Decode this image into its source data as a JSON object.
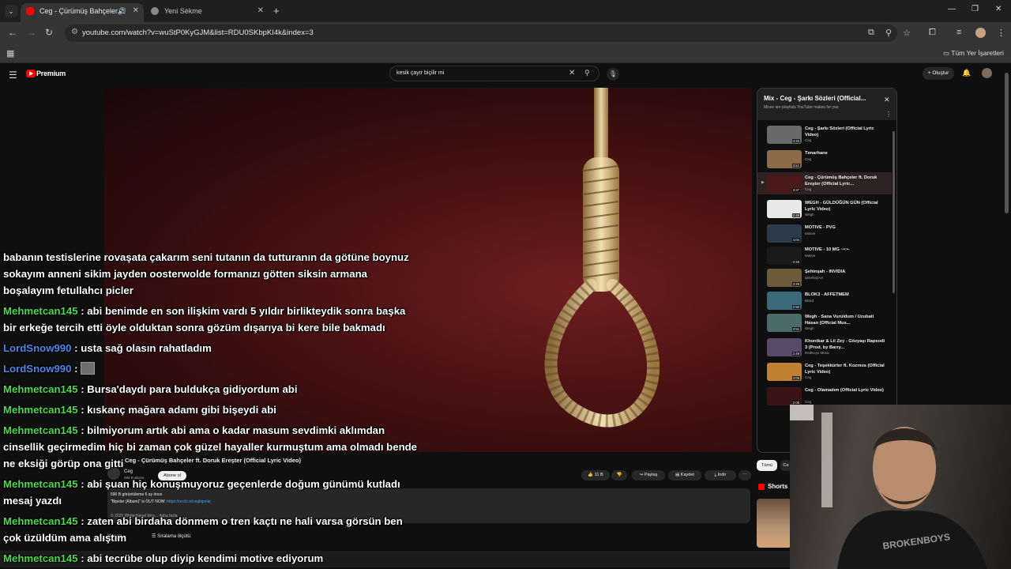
{
  "browser": {
    "tabs": [
      {
        "title": "Ceg - Çürümüş Bahçeler ft.",
        "active": true
      },
      {
        "title": "Yeni Sekme",
        "active": false
      }
    ],
    "url": "youtube.com/watch?v=wuStP0KyGJM&list=RDU0SKbpKI4k&index=3",
    "bookmarks_label": "Tüm Yer İşaretleri"
  },
  "youtube": {
    "brand": "Premium",
    "search_query": "kesik çayır biçilir mi",
    "create_label": "Oluştur",
    "video_title": "Ceg - Çürümüş Bahçeler ft. Doruk Ereşter (Official Lyric Video)",
    "channel": "Ceg",
    "channel_subs": "294 B abone",
    "subscribe_label": "Abone ol",
    "likes": "11 B",
    "share_label": "Paylaş",
    "save_label": "Kaydet",
    "download_label": "İndir",
    "desc_views": "590 B görüntüleme  6 ay önce",
    "desc_line2": "\"Bipolar (Album)\" is OUT NOW: ",
    "desc_link": "https://orcd.co/cegbipolar",
    "desc_line3": "© 2025 Whitechapel Mus...  daha fazla",
    "comments_label": "Yorum",
    "sort_label": "Sıralama ölçütü:",
    "chips": [
      "Tümü",
      "Ce"
    ],
    "shorts_label": "Shorts"
  },
  "playlist": {
    "title": "Mix - Ceg - Şarkı Sözleri (Official...",
    "subtitle": "Mixes are playlists YouTube makes for you",
    "items": [
      {
        "title": "Ceg - Şarkı Sözleri (Official Lyric Video)",
        "artist": "Ceg",
        "duration": "4:33"
      },
      {
        "title": "Tımarhane",
        "artist": "Ceg",
        "duration": "3:51"
      },
      {
        "title": "Ceg - Çürümüş Bahçeler ft. Doruk Ereşter (Official Lyric...",
        "artist": "Ceg",
        "duration": "3:37"
      },
      {
        "title": "WEGH - GÜLDÜĞÜN GÜN (Official Lyric Video)",
        "artist": "Wegh",
        "duration": "2:49"
      },
      {
        "title": "MOTIVE - PVG",
        "artist": "Motive",
        "duration": "4:04"
      },
      {
        "title": "MOTIVE - 10 MG ~•:•-",
        "artist": "Motive",
        "duration": "2:28"
      },
      {
        "title": "Şehinşah - INVIDIA",
        "artist": "ŞEHİNŞAH",
        "duration": "3:29"
      },
      {
        "title": "BLOK3 - AFFETMEM",
        "artist": "Blok3",
        "duration": "2:50"
      },
      {
        "title": "Wegh - Sana Vuruldum / Uzubati Hasan (Official Mus...",
        "artist": "Wegh",
        "duration": "3:51"
      },
      {
        "title": "Khontkar & Lil Zey - Gözyaşı Rapsodi 3 (Prod. by Barry...",
        "artist": "RedKeys Music",
        "duration": "2:49"
      },
      {
        "title": "Ceg - Teşekkürler ft. Kozmos (Official Lyric Video)",
        "artist": "Ceg",
        "duration": "4:05"
      },
      {
        "title": "Ceg - Olamadım (Official Lyric Video)",
        "artist": "Ceg",
        "duration": "2:06"
      }
    ]
  },
  "chat": {
    "messages": [
      {
        "user": "",
        "text": "babanın testislerine rovaşata çakarım seni tutanın da tutturanın da götüne boynuz"
      },
      {
        "user": "",
        "text": "sokayım anneni sikim jayden oosterwolde formanızı götten siksin armana"
      },
      {
        "user": "",
        "text": "boşalayım fetullahcı picler"
      },
      {
        "user": "Mehmetcan145",
        "text": " : abi benimde en son ilişkim vardı 5 yıldır birlikteydik sonra başka"
      },
      {
        "user": "",
        "text": "bir erkeğe tercih etti öyle olduktan sonra gözüm dışarıya bi kere bile bakmadı"
      },
      {
        "user": "LordSnow990",
        "text": " : usta sağ olasın rahatladım"
      },
      {
        "user": "LordSnow990",
        "text": " : "
      },
      {
        "user": "Mehmetcan145",
        "text": " : Bursa'daydı para buldukça gidiyordum abi"
      },
      {
        "user": "Mehmetcan145",
        "text": " : kıskanç mağara adamı gibi bişeydi abi"
      },
      {
        "user": "Mehmetcan145",
        "text": " : bilmiyorum artık abi ama o kadar masum sevdimki aklımdan"
      },
      {
        "user": "",
        "text": "cinsellik geçirmedim hiç bi zaman çok güzel hayaller kurmuştum ama olmadı bende"
      },
      {
        "user": "",
        "text": "ne eksiği görüp ona gitti"
      },
      {
        "user": "Mehmetcan145",
        "text": " : abi şuan hiç konuşmuyoruz geçenlerde doğum günümü kutladı"
      },
      {
        "user": "",
        "text": "mesaj yazdı"
      },
      {
        "user": "Mehmetcan145",
        "text": " : zaten abi birdaha dönmem o tren kaçtı ne hali varsa görsün ben"
      },
      {
        "user": "",
        "text": "çok üzüldüm ama alıştım"
      },
      {
        "user": "Mehmetcan145",
        "text": " : abi tecrübe olup diyip kendimi motive ediyorum"
      }
    ]
  },
  "colors": {
    "chat_green": "#4dd84d",
    "chat_blue": "#4f86e6",
    "yt_red": "#ff0000",
    "bg": "#0f0f0f"
  }
}
